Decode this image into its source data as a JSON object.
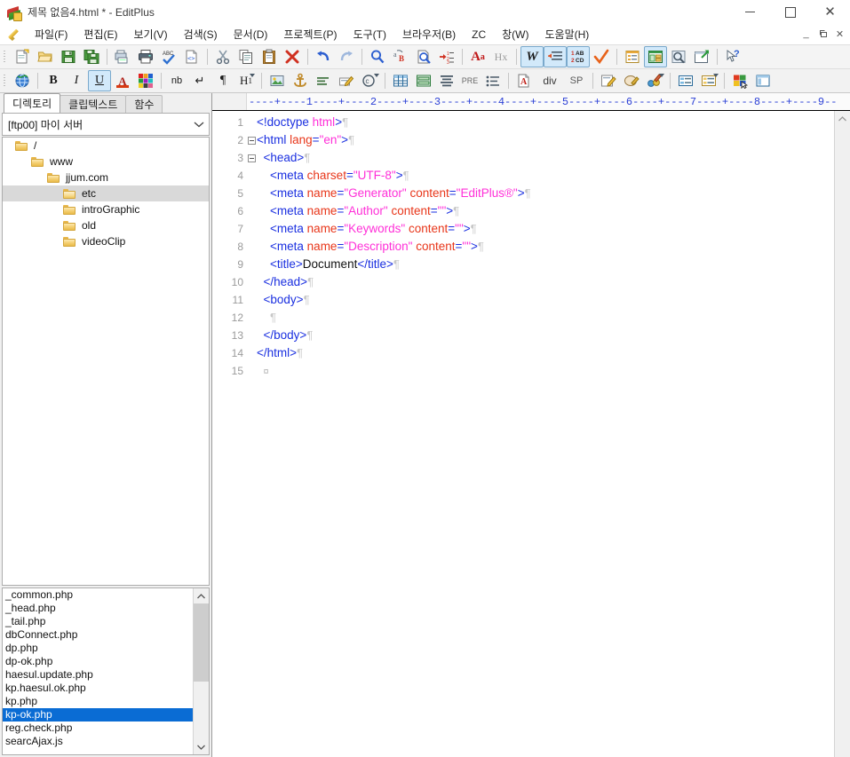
{
  "window": {
    "title": "제목 없음4.html * - EditPlus",
    "app_icon": "editplus-icon",
    "controls": {
      "minimize": "–",
      "maximize": "□",
      "close": "✕"
    },
    "mdi_controls": {
      "minimize": "_",
      "restore": "⧉",
      "close": "✕"
    }
  },
  "menu": {
    "icon": "pencil-icon",
    "items": [
      {
        "label": "파일(F)",
        "name": "menu-file"
      },
      {
        "label": "편집(E)",
        "name": "menu-edit"
      },
      {
        "label": "보기(V)",
        "name": "menu-view"
      },
      {
        "label": "검색(S)",
        "name": "menu-search"
      },
      {
        "label": "문서(D)",
        "name": "menu-document"
      },
      {
        "label": "프로젝트(P)",
        "name": "menu-project"
      },
      {
        "label": "도구(T)",
        "name": "menu-tools"
      },
      {
        "label": "브라우저(B)",
        "name": "menu-browser"
      },
      {
        "label": "ZC",
        "name": "menu-zc"
      },
      {
        "label": "창(W)",
        "name": "menu-window"
      },
      {
        "label": "도움말(H)",
        "name": "menu-help"
      }
    ]
  },
  "toolbar_main": {
    "buttons": [
      {
        "name": "new-file-icon",
        "tip": "새 파일"
      },
      {
        "name": "open-file-icon",
        "tip": "열기"
      },
      {
        "name": "save-icon",
        "tip": "저장"
      },
      {
        "name": "save-all-icon",
        "tip": "모두 저장"
      },
      {
        "name": "print-preview-icon",
        "tip": "인쇄 미리보기"
      },
      {
        "name": "print-icon",
        "tip": "인쇄"
      },
      {
        "name": "spellcheck-icon",
        "tip": "맞춤법"
      },
      {
        "name": "view-source-icon",
        "tip": "소스 보기"
      },
      {
        "name": "cut-icon",
        "tip": "잘라내기"
      },
      {
        "name": "copy-icon",
        "tip": "복사"
      },
      {
        "name": "paste-icon",
        "tip": "붙여넣기"
      },
      {
        "name": "delete-icon",
        "tip": "삭제"
      },
      {
        "name": "undo-icon",
        "tip": "실행 취소"
      },
      {
        "name": "redo-icon",
        "tip": "다시 실행"
      },
      {
        "name": "find-icon",
        "tip": "찾기"
      },
      {
        "name": "replace-icon",
        "tip": "바꾸기"
      },
      {
        "name": "find-in-files-icon",
        "tip": "파일에서 찾기"
      },
      {
        "name": "goto-line-icon",
        "tip": "줄 이동"
      },
      {
        "name": "font-icon",
        "label": "Aa",
        "tip": "글꼴"
      },
      {
        "name": "hex-view-icon",
        "label": "Hx",
        "tip": "HEX 보기"
      },
      {
        "name": "word-wrap-icon",
        "label": "W",
        "tip": "자동 줄바꿈",
        "active": true
      },
      {
        "name": "auto-indent-icon",
        "tip": "자동 들여쓰기",
        "active": true
      },
      {
        "name": "line-numbers-icon",
        "tip": "줄 번호",
        "active": true
      },
      {
        "name": "check-syntax-icon",
        "tip": "구문 검사"
      },
      {
        "name": "document-selector-icon",
        "tip": "문서 선택기"
      },
      {
        "name": "directory-window-icon",
        "tip": "디렉토리 창",
        "active": true
      },
      {
        "name": "preview-icon",
        "tip": "미리보기"
      },
      {
        "name": "browser-icon",
        "tip": "브라우저에서 보기"
      },
      {
        "name": "context-help-icon",
        "tip": "도움말"
      }
    ]
  },
  "toolbar_html": {
    "buttons": [
      {
        "name": "globe-link-icon",
        "tip": "링크"
      },
      {
        "name": "bold-icon",
        "label": "B",
        "tip": "굵게"
      },
      {
        "name": "italic-icon",
        "label": "I",
        "tip": "기울임"
      },
      {
        "name": "underline-icon",
        "label": "U",
        "tip": "밑줄",
        "active": true
      },
      {
        "name": "font-color-icon",
        "label": "A",
        "tip": "글자 색"
      },
      {
        "name": "color-palette-icon",
        "tip": "색상표"
      },
      {
        "name": "nbsp-icon",
        "label": "nb",
        "tip": "공백 문자"
      },
      {
        "name": "line-break-icon",
        "label": "↵",
        "tip": "줄바꿈"
      },
      {
        "name": "paragraph-icon",
        "label": "¶",
        "tip": "문단"
      },
      {
        "name": "heading-icon",
        "label": "H1",
        "tip": "제목"
      },
      {
        "name": "image-icon",
        "tip": "이미지"
      },
      {
        "name": "anchor-icon",
        "tip": "앵커"
      },
      {
        "name": "align-icon",
        "tip": "정렬"
      },
      {
        "name": "edit-marker-icon",
        "tip": "편집"
      },
      {
        "name": "copyright-icon",
        "label": "©",
        "tip": "특수문자"
      },
      {
        "name": "table-icon",
        "tip": "표"
      },
      {
        "name": "form-icon",
        "tip": "폼"
      },
      {
        "name": "blockquote-icon",
        "tip": "인용"
      },
      {
        "name": "pre-icon",
        "label": "PRE",
        "tip": "PRE 태그"
      },
      {
        "name": "list-icon",
        "tip": "목록"
      },
      {
        "name": "anchor-tag-icon",
        "label": "A",
        "tip": "A 태그"
      },
      {
        "name": "div-tag-icon",
        "label": "div",
        "tip": "DIV 태그"
      },
      {
        "name": "span-tag-icon",
        "label": "SP",
        "tip": "SPAN 태그"
      },
      {
        "name": "css-edit-icon",
        "tip": "CSS 편집"
      },
      {
        "name": "css-view-icon",
        "tip": "CSS 보기"
      },
      {
        "name": "css-color-icon",
        "tip": "CSS 색상"
      },
      {
        "name": "properties-icon",
        "tip": "속성"
      },
      {
        "name": "attributes-icon",
        "tip": "특성"
      },
      {
        "name": "color-picker-icon",
        "tip": "색상 선택"
      },
      {
        "name": "layout-icon",
        "tip": "레이아웃"
      }
    ]
  },
  "sidebar": {
    "tabs": [
      {
        "label": "디렉토리",
        "name": "tab-directory",
        "active": true
      },
      {
        "label": "클립텍스트",
        "name": "tab-cliptext",
        "active": false
      },
      {
        "label": "함수",
        "name": "tab-functions",
        "active": false
      }
    ],
    "server_combo": {
      "value": "[ftp00] 마이 서버",
      "arrow": "⌄"
    },
    "tree": [
      {
        "label": "/",
        "depth": 0,
        "selected": false,
        "open": false
      },
      {
        "label": "www",
        "depth": 1,
        "selected": false,
        "open": false
      },
      {
        "label": "jjum.com",
        "depth": 2,
        "selected": false,
        "open": false
      },
      {
        "label": "etc",
        "depth": 3,
        "selected": true,
        "open": true
      },
      {
        "label": "introGraphic",
        "depth": 3,
        "selected": false,
        "open": false
      },
      {
        "label": "old",
        "depth": 3,
        "selected": false,
        "open": false
      },
      {
        "label": "videoClip",
        "depth": 3,
        "selected": false,
        "open": false
      }
    ],
    "files": [
      {
        "name": "_common.php",
        "selected": false
      },
      {
        "name": "_head.php",
        "selected": false
      },
      {
        "name": "_tail.php",
        "selected": false
      },
      {
        "name": "dbConnect.php",
        "selected": false
      },
      {
        "name": "dp.php",
        "selected": false
      },
      {
        "name": "dp-ok.php",
        "selected": false
      },
      {
        "name": "haesul.update.php",
        "selected": false
      },
      {
        "name": "kp.haesul.ok.php",
        "selected": false
      },
      {
        "name": "kp.php",
        "selected": false
      },
      {
        "name": "kp-ok.php",
        "selected": true
      },
      {
        "name": "reg.check.php",
        "selected": false
      },
      {
        "name": "searcAjax.js",
        "selected": false
      }
    ],
    "scrollbar": {
      "up": "⌃",
      "down": "⌄"
    }
  },
  "editor": {
    "ruler": "----+----1----+----2----+----3----+----4----+----5----+----6----+----7----+----8----+----9--",
    "scrollbar": {
      "up": "⌃",
      "down": "⌄"
    },
    "colors": {
      "tag": "#1a2fe0",
      "attribute": "#e8361a",
      "value": "#ff2fd8",
      "text": "#111111",
      "pilcrow": "#c8c8c8",
      "line_number": "#9a9a9a"
    },
    "lines": [
      {
        "num": "1",
        "indent": 0,
        "fold": false,
        "tokens": [
          {
            "t": "tag",
            "v": "<!doctype "
          },
          {
            "t": "val",
            "v": "html"
          },
          {
            "t": "tag",
            "v": ">"
          },
          {
            "t": "pil",
            "v": "¶"
          }
        ]
      },
      {
        "num": "2",
        "indent": 0,
        "fold": true,
        "tokens": [
          {
            "t": "tag",
            "v": "<html "
          },
          {
            "t": "att",
            "v": "lang"
          },
          {
            "t": "tag",
            "v": "="
          },
          {
            "t": "val",
            "v": "\"en\""
          },
          {
            "t": "tag",
            "v": ">"
          },
          {
            "t": "pil",
            "v": "¶"
          }
        ]
      },
      {
        "num": "3",
        "indent": 1,
        "fold": true,
        "tokens": [
          {
            "t": "tag",
            "v": "<head>"
          },
          {
            "t": "pil",
            "v": "¶"
          }
        ]
      },
      {
        "num": "4",
        "indent": 2,
        "fold": false,
        "tokens": [
          {
            "t": "tag",
            "v": "<meta "
          },
          {
            "t": "att",
            "v": "charset"
          },
          {
            "t": "tag",
            "v": "="
          },
          {
            "t": "val",
            "v": "\"UTF-8\""
          },
          {
            "t": "tag",
            "v": ">"
          },
          {
            "t": "pil",
            "v": "¶"
          }
        ]
      },
      {
        "num": "5",
        "indent": 2,
        "fold": false,
        "tokens": [
          {
            "t": "tag",
            "v": "<meta "
          },
          {
            "t": "att",
            "v": "name"
          },
          {
            "t": "tag",
            "v": "="
          },
          {
            "t": "val",
            "v": "\"Generator\""
          },
          {
            "t": "tag",
            "v": " "
          },
          {
            "t": "att",
            "v": "content"
          },
          {
            "t": "tag",
            "v": "="
          },
          {
            "t": "val",
            "v": "\"EditPlus®\""
          },
          {
            "t": "tag",
            "v": ">"
          },
          {
            "t": "pil",
            "v": "¶"
          }
        ]
      },
      {
        "num": "6",
        "indent": 2,
        "fold": false,
        "tokens": [
          {
            "t": "tag",
            "v": "<meta "
          },
          {
            "t": "att",
            "v": "name"
          },
          {
            "t": "tag",
            "v": "="
          },
          {
            "t": "val",
            "v": "\"Author\""
          },
          {
            "t": "tag",
            "v": " "
          },
          {
            "t": "att",
            "v": "content"
          },
          {
            "t": "tag",
            "v": "="
          },
          {
            "t": "val",
            "v": "\"\""
          },
          {
            "t": "tag",
            "v": ">"
          },
          {
            "t": "pil",
            "v": "¶"
          }
        ]
      },
      {
        "num": "7",
        "indent": 2,
        "fold": false,
        "tokens": [
          {
            "t": "tag",
            "v": "<meta "
          },
          {
            "t": "att",
            "v": "name"
          },
          {
            "t": "tag",
            "v": "="
          },
          {
            "t": "val",
            "v": "\"Keywords\""
          },
          {
            "t": "tag",
            "v": " "
          },
          {
            "t": "att",
            "v": "content"
          },
          {
            "t": "tag",
            "v": "="
          },
          {
            "t": "val",
            "v": "\"\""
          },
          {
            "t": "tag",
            "v": ">"
          },
          {
            "t": "pil",
            "v": "¶"
          }
        ]
      },
      {
        "num": "8",
        "indent": 2,
        "fold": false,
        "tokens": [
          {
            "t": "tag",
            "v": "<meta "
          },
          {
            "t": "att",
            "v": "name"
          },
          {
            "t": "tag",
            "v": "="
          },
          {
            "t": "val",
            "v": "\"Description\""
          },
          {
            "t": "tag",
            "v": " "
          },
          {
            "t": "att",
            "v": "content"
          },
          {
            "t": "tag",
            "v": "="
          },
          {
            "t": "val",
            "v": "\"\""
          },
          {
            "t": "tag",
            "v": ">"
          },
          {
            "t": "pil",
            "v": "¶"
          }
        ]
      },
      {
        "num": "9",
        "indent": 2,
        "fold": false,
        "tokens": [
          {
            "t": "tag",
            "v": "<title>"
          },
          {
            "t": "txt",
            "v": "Document"
          },
          {
            "t": "tag",
            "v": "</title>"
          },
          {
            "t": "pil",
            "v": "¶"
          }
        ]
      },
      {
        "num": "10",
        "indent": 1,
        "fold": false,
        "tokens": [
          {
            "t": "tag",
            "v": "</head>"
          },
          {
            "t": "pil",
            "v": "¶"
          }
        ]
      },
      {
        "num": "11",
        "indent": 1,
        "fold": false,
        "tokens": [
          {
            "t": "tag",
            "v": "<body>"
          },
          {
            "t": "pil",
            "v": "¶"
          }
        ]
      },
      {
        "num": "12",
        "indent": 2,
        "fold": false,
        "tokens": [
          {
            "t": "pil",
            "v": "¶"
          }
        ]
      },
      {
        "num": "13",
        "indent": 1,
        "fold": false,
        "tokens": [
          {
            "t": "tag",
            "v": "</body>"
          },
          {
            "t": "pil",
            "v": "¶"
          }
        ]
      },
      {
        "num": "14",
        "indent": 0,
        "fold": false,
        "tokens": [
          {
            "t": "tag",
            "v": "</html>"
          },
          {
            "t": "pil",
            "v": "¶"
          }
        ]
      },
      {
        "num": "15",
        "indent": 1,
        "fold": false,
        "tokens": [
          {
            "t": "eof",
            "v": "¤"
          }
        ]
      }
    ]
  }
}
